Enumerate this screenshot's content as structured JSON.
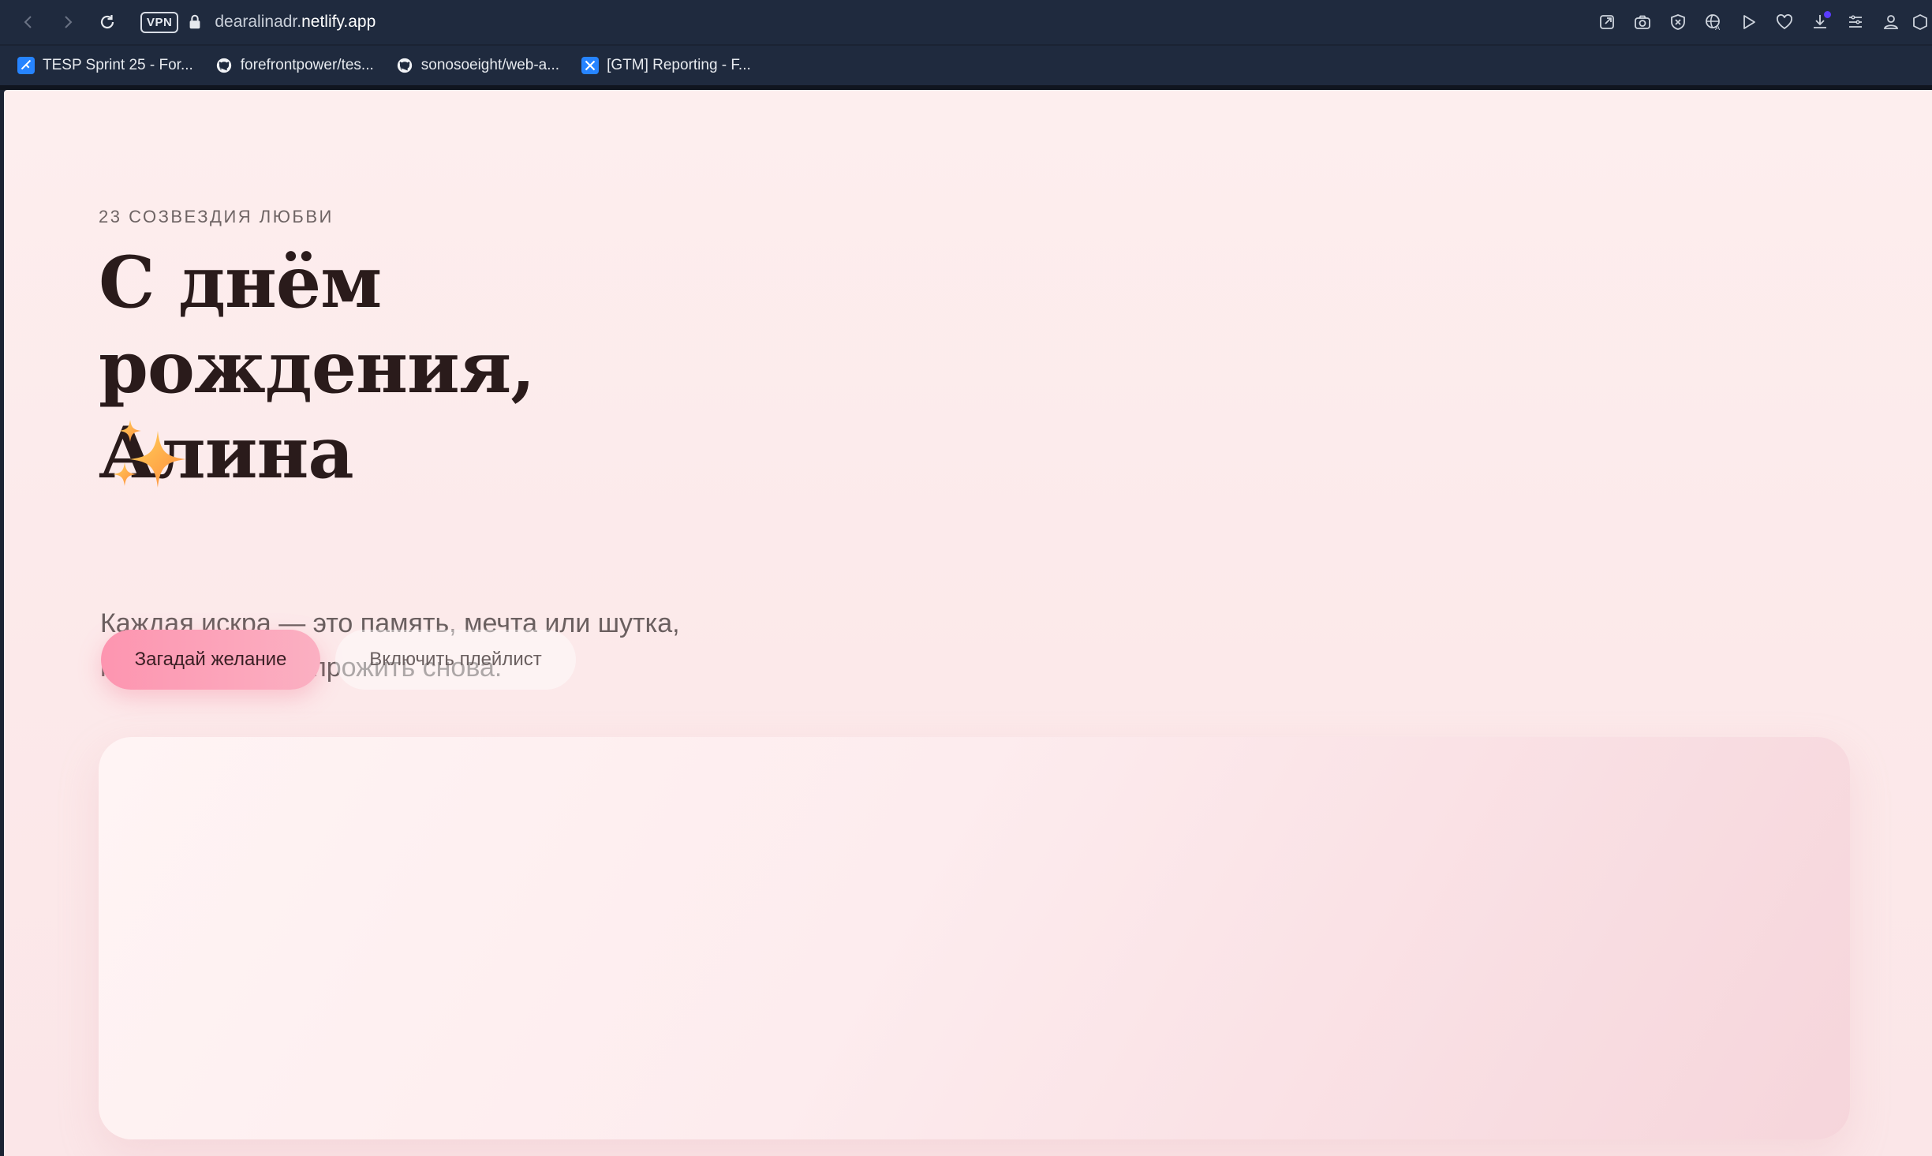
{
  "browser": {
    "vpn_label": "VPN",
    "url_prefix": "dearalinadr.",
    "url_host": "netlify.app",
    "bookmarks": [
      {
        "label": "TESP Sprint 25 - For...",
        "icon": "jira-icon"
      },
      {
        "label": "forefrontpower/tes...",
        "icon": "github-icon"
      },
      {
        "label": "sonosoeight/web-a...",
        "icon": "github-icon"
      },
      {
        "label": "[GTM] Reporting - F...",
        "icon": "jira-icon"
      }
    ],
    "toolbar_icons": [
      "share-icon",
      "camera-icon",
      "shield-icon",
      "translate-icon",
      "play-icon",
      "heart-icon",
      "download-icon",
      "menu-icon",
      "profile-icon"
    ],
    "colors": {
      "chrome": "#1f2a3e",
      "download_badge": "#5b3cff"
    }
  },
  "hero": {
    "eyebrow": "23 СОЗВЕЗДИЯ ЛЮБВИ",
    "headline": "С днём рождения, Алина",
    "emoji": "✨",
    "lead": "Каждая искра — это память, мечта или шутка, которую хочется прожить снова.",
    "primary_button": "Загадай желание",
    "secondary_button": "Включить плейлист"
  },
  "colors": {
    "page_bg": "#fdeeee",
    "headline": "#2a1b1b",
    "primary_button": "#fd95b0"
  }
}
